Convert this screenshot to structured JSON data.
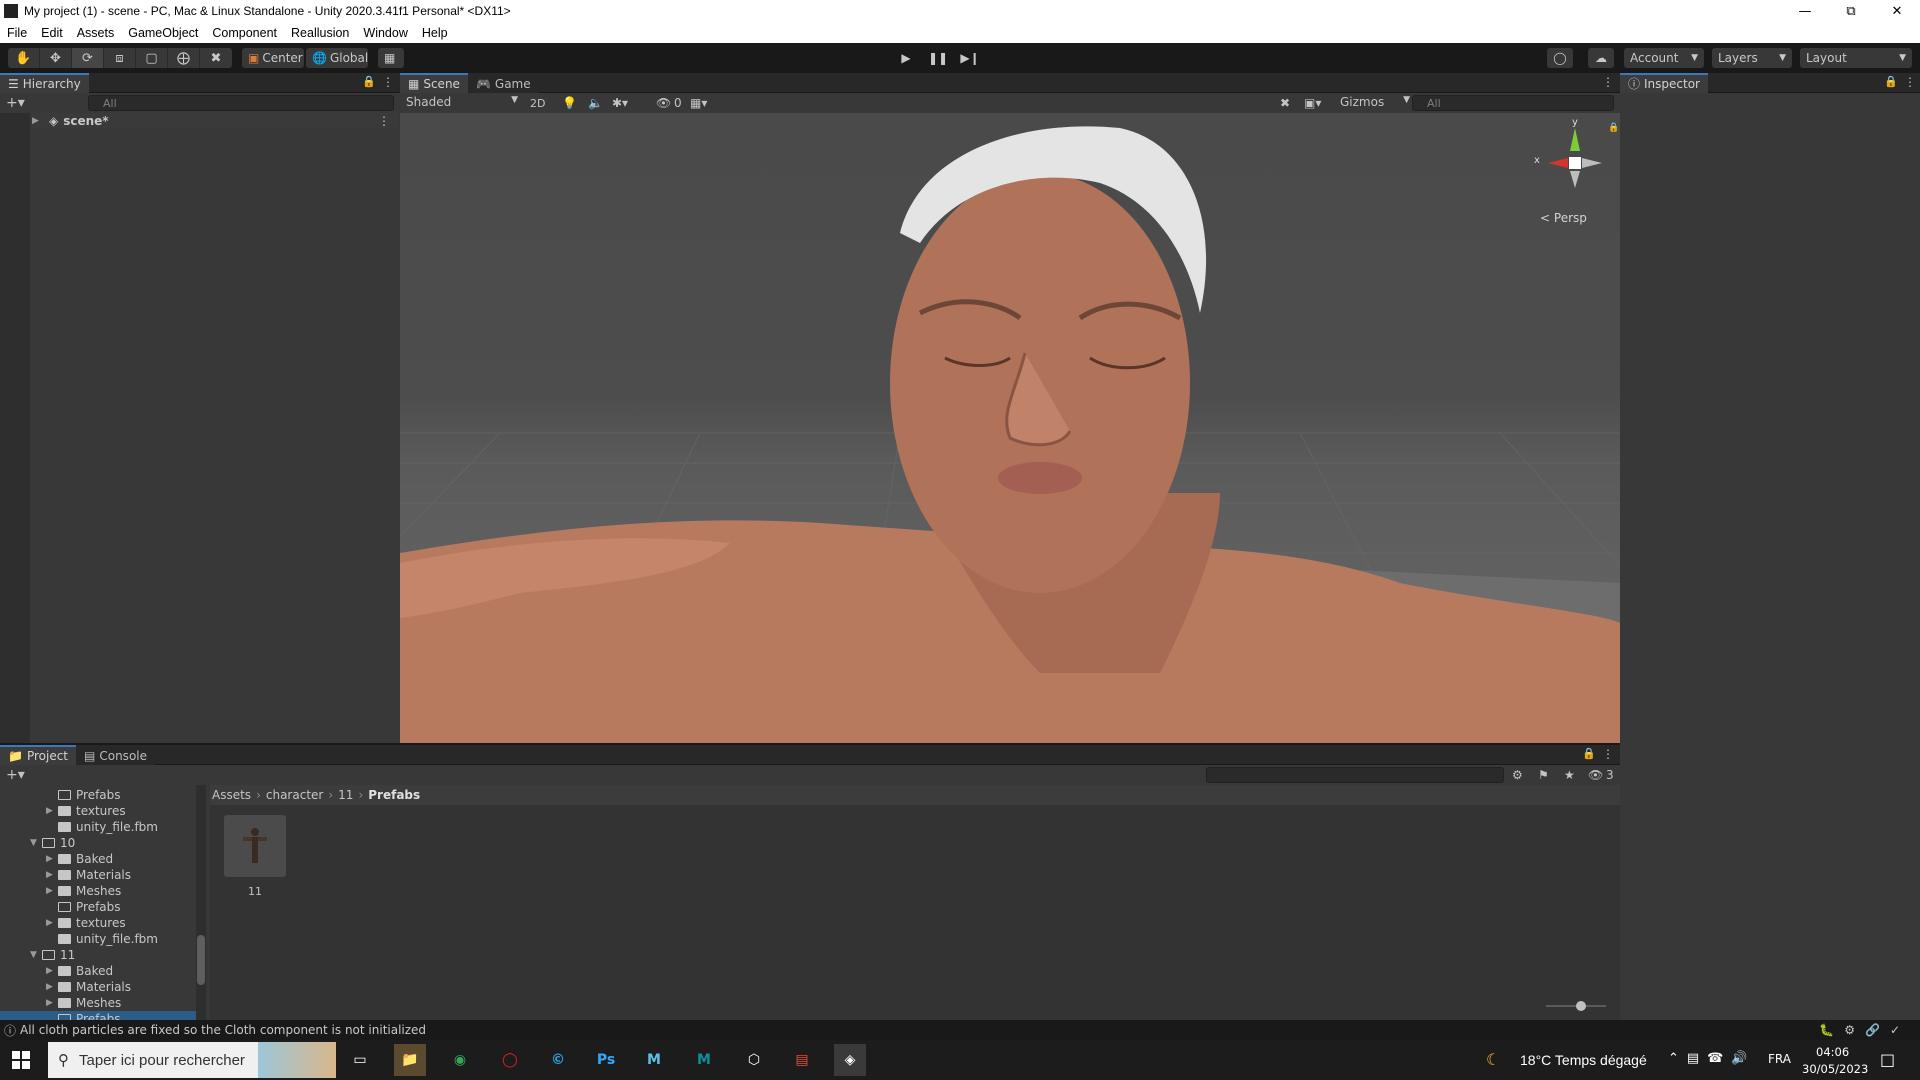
{
  "window": {
    "title": "My project (1) - scene - PC, Mac & Linux Standalone - Unity 2020.3.41f1 Personal* <DX11>"
  },
  "menu": [
    "File",
    "Edit",
    "Assets",
    "GameObject",
    "Component",
    "Reallusion",
    "Window",
    "Help"
  ],
  "toolbar": {
    "center_label": "Center",
    "global_label": "Global",
    "account_label": "Account",
    "layers_label": "Layers",
    "layout_label": "Layout"
  },
  "hierarchy": {
    "tab": "Hierarchy",
    "search_placeholder": "All",
    "root": "scene*"
  },
  "scene": {
    "tab_scene": "Scene",
    "tab_game": "Game",
    "shading": "Shaded",
    "mode_2d": "2D",
    "hidden_count": "0",
    "gizmos": "Gizmos",
    "search_placeholder": "All",
    "persp": "Persp",
    "axis_x": "x",
    "axis_y": "y"
  },
  "inspector": {
    "tab": "Inspector"
  },
  "project": {
    "tab_project": "Project",
    "tab_console": "Console",
    "hidden_count": "3",
    "breadcrumb": [
      "Assets",
      "character",
      "11",
      "Prefabs"
    ],
    "tree": [
      {
        "label": "Prefabs",
        "depth": 2,
        "arrow": "",
        "filled": false
      },
      {
        "label": "textures",
        "depth": 2,
        "arrow": "▶",
        "filled": true
      },
      {
        "label": "unity_file.fbm",
        "depth": 2,
        "arrow": "",
        "filled": true
      },
      {
        "label": "10",
        "depth": 1,
        "arrow": "▼",
        "filled": false
      },
      {
        "label": "Baked",
        "depth": 2,
        "arrow": "▶",
        "filled": true
      },
      {
        "label": "Materials",
        "depth": 2,
        "arrow": "▶",
        "filled": true
      },
      {
        "label": "Meshes",
        "depth": 2,
        "arrow": "▶",
        "filled": true
      },
      {
        "label": "Prefabs",
        "depth": 2,
        "arrow": "",
        "filled": false
      },
      {
        "label": "textures",
        "depth": 2,
        "arrow": "▶",
        "filled": true
      },
      {
        "label": "unity_file.fbm",
        "depth": 2,
        "arrow": "",
        "filled": true
      },
      {
        "label": "11",
        "depth": 1,
        "arrow": "▼",
        "filled": false
      },
      {
        "label": "Baked",
        "depth": 2,
        "arrow": "▶",
        "filled": true
      },
      {
        "label": "Materials",
        "depth": 2,
        "arrow": "▶",
        "filled": true
      },
      {
        "label": "Meshes",
        "depth": 2,
        "arrow": "▶",
        "filled": true
      },
      {
        "label": "Prefabs",
        "depth": 2,
        "arrow": "",
        "filled": false
      }
    ],
    "asset_label": "11"
  },
  "status": {
    "message": "All cloth particles are fixed so the Cloth component is not initialized"
  },
  "taskbar": {
    "search_placeholder": "Taper ici pour rechercher",
    "weather": "18°C  Temps dégagé",
    "lang": "FRA",
    "time": "04:06",
    "date": "30/05/2023"
  }
}
